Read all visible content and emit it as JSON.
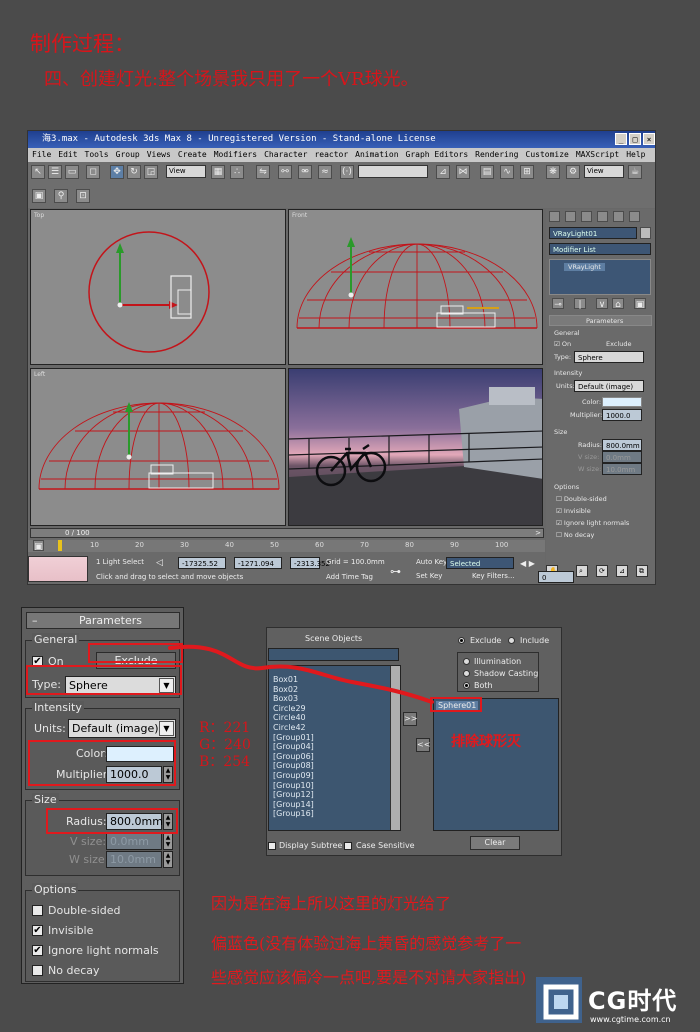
{
  "header": {
    "line1": "制作过程：",
    "line2": "四、创建灯光:整个场景我只用了一个VR球光。"
  },
  "app": {
    "title": "海3.max - Autodesk 3ds Max 8 - Unregistered Version - Stand-alone License",
    "menu": [
      "File",
      "Edit",
      "Tools",
      "Group",
      "Views",
      "Create",
      "Modifiers",
      "Character",
      "reactor",
      "Animation",
      "Graph Editors",
      "Rendering",
      "Customize",
      "MAXScript",
      "Help"
    ],
    "toolbar_view1": "View",
    "toolbar_view2": "View",
    "viewports": {
      "top": "Top",
      "front": "Front",
      "left": "Left"
    },
    "cmd": {
      "object_name": "VRayLight01",
      "modifier_list": "Modifier List",
      "stack_item": "VRayLight",
      "rollout": "Parameters",
      "general": "General",
      "on": "On",
      "exclude": "Exclude",
      "type_label": "Type:",
      "type": "Sphere",
      "intensity": "Intensity",
      "units_label": "Units:",
      "units": "Default (image)",
      "color_label": "Color:",
      "multiplier_label": "Multiplier:",
      "multiplier": "1000.0",
      "size": "Size",
      "radius_label": "Radius:",
      "radius": "800.0mm",
      "vsize_label": "V size:",
      "vsize": "0.0mm",
      "wsize_label": "W size:",
      "wsize": "10.0mm",
      "options": "Options",
      "opt1": "Double-sided",
      "opt2": "Invisible",
      "opt3": "Ignore light normals",
      "opt4": "No decay"
    },
    "timeline": {
      "frame": "0 / 100",
      "ticks": [
        "10",
        "20",
        "30",
        "40",
        "50",
        "60",
        "70",
        "80",
        "90",
        "100"
      ]
    },
    "status": {
      "selected": "1 Light Select",
      "x": "-17325.52",
      "y": "-1271.094",
      "z": "-2313.352",
      "grid": "Grid = 100.0mm",
      "autokey": "Auto Key",
      "selected_dd": "Selected",
      "setkey": "Set Key",
      "keyfilters": "Key Filters...",
      "frame_field": "0",
      "prompt": "Click and drag to select and move objects",
      "addtime": "Add Time Tag"
    }
  },
  "params": {
    "rollout": "Parameters",
    "general": "General",
    "on": "On",
    "exclude": "Exclude",
    "type_label": "Type:",
    "type": "Sphere",
    "intensity": "Intensity",
    "units_label": "Units:",
    "units": "Default (image)",
    "color_label": "Color:",
    "multiplier_label": "Multiplier:",
    "multiplier": "1000.0",
    "size": "Size",
    "radius_label": "Radius:",
    "radius": "800.0mm",
    "vsize_label": "V size:",
    "vsize": "0.0mm",
    "wsize_label": "W size:",
    "wsize": "10.0mm",
    "options": "Options",
    "opt1": "Double-sided",
    "opt2": "Invisible",
    "opt3": "Ignore light normals",
    "opt4": "No decay"
  },
  "exclude_dialog": {
    "scene_objects": "Scene Objects",
    "items": [
      "Box01",
      "Box02",
      "Box03",
      "Circle29",
      "Circle40",
      "Circle42",
      "[Group01]",
      "[Group04]",
      "[Group06]",
      "[Group08]",
      "[Group09]",
      "[Group10]",
      "[Group12]",
      "[Group14]",
      "[Group16]"
    ],
    "exclude": "Exclude",
    "include": "Include",
    "illumination": "Illumination",
    "shadow": "Shadow Casting",
    "both": "Both",
    "selected_item": "Sphere01",
    "move_right": ">>",
    "move_left": "<<",
    "clear": "Clear",
    "display_subtree": "Display Subtree",
    "case_sensitive": "Case Sensitive"
  },
  "rgb": {
    "r": "R：221",
    "g": "G：240",
    "b": "B：254"
  },
  "annotation_exclude": "排除球形灭",
  "notes": {
    "line1": "因为是在海上所以这里的灯光给了",
    "line2": "偏蓝色(没有体验过海上黄昏的感觉参考了一",
    "line3": "些感觉应该偏冷一点吧,要是不对请大家指出)"
  },
  "watermark": {
    "brand": "CG时代",
    "url": "www.cgtime.com.cn"
  },
  "colors": {
    "accent_red": "#e0191d",
    "light_color": "#ddf0fe"
  }
}
